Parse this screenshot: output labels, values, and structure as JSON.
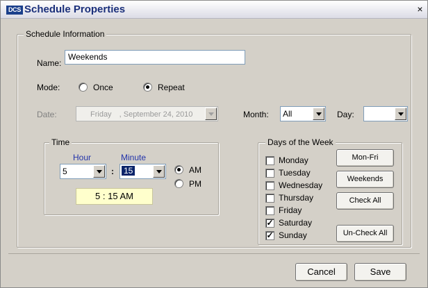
{
  "window": {
    "icon_text": "DCS",
    "title": "Schedule Properties",
    "close_glyph": "×"
  },
  "schedule_info": {
    "group_label": "Schedule Information",
    "name_label": "Name:",
    "name_value": "Weekends",
    "mode_label": "Mode:",
    "mode_options": [
      "Once",
      "Repeat"
    ],
    "mode_selected": "Repeat",
    "date_label": "Date:",
    "date_value_day": "Friday",
    "date_value_rest": ", September 24, 2010",
    "month_label": "Month:",
    "month_value": "All",
    "day_label": "Day:",
    "day_value": ""
  },
  "time": {
    "group_label": "Time",
    "hour_label": "Hour",
    "minute_label": "Minute",
    "hour_value": "5",
    "separator": ":",
    "minute_value": "15",
    "am_label": "AM",
    "pm_label": "PM",
    "ampm_selected": "AM",
    "display": "5 : 15 AM"
  },
  "days_of_week": {
    "group_label": "Days of the Week",
    "days": [
      {
        "label": "Monday",
        "checked": false
      },
      {
        "label": "Tuesday",
        "checked": false
      },
      {
        "label": "Wednesday",
        "checked": false
      },
      {
        "label": "Thursday",
        "checked": false
      },
      {
        "label": "Friday",
        "checked": false
      },
      {
        "label": "Saturday",
        "checked": true
      },
      {
        "label": "Sunday",
        "checked": true
      }
    ],
    "check_glyph": "✓",
    "buttons": {
      "mon_fri": "Mon-Fri",
      "weekends": "Weekends",
      "check_all": "Check All",
      "uncheck_all": "Un-Check All"
    }
  },
  "footer": {
    "cancel": "Cancel",
    "save": "Save"
  },
  "colors": {
    "dialog_bg": "#d4d0c8",
    "title_text": "#1a2f7a",
    "time_display_bg": "#ffffcc",
    "label_blue": "#2233aa"
  }
}
